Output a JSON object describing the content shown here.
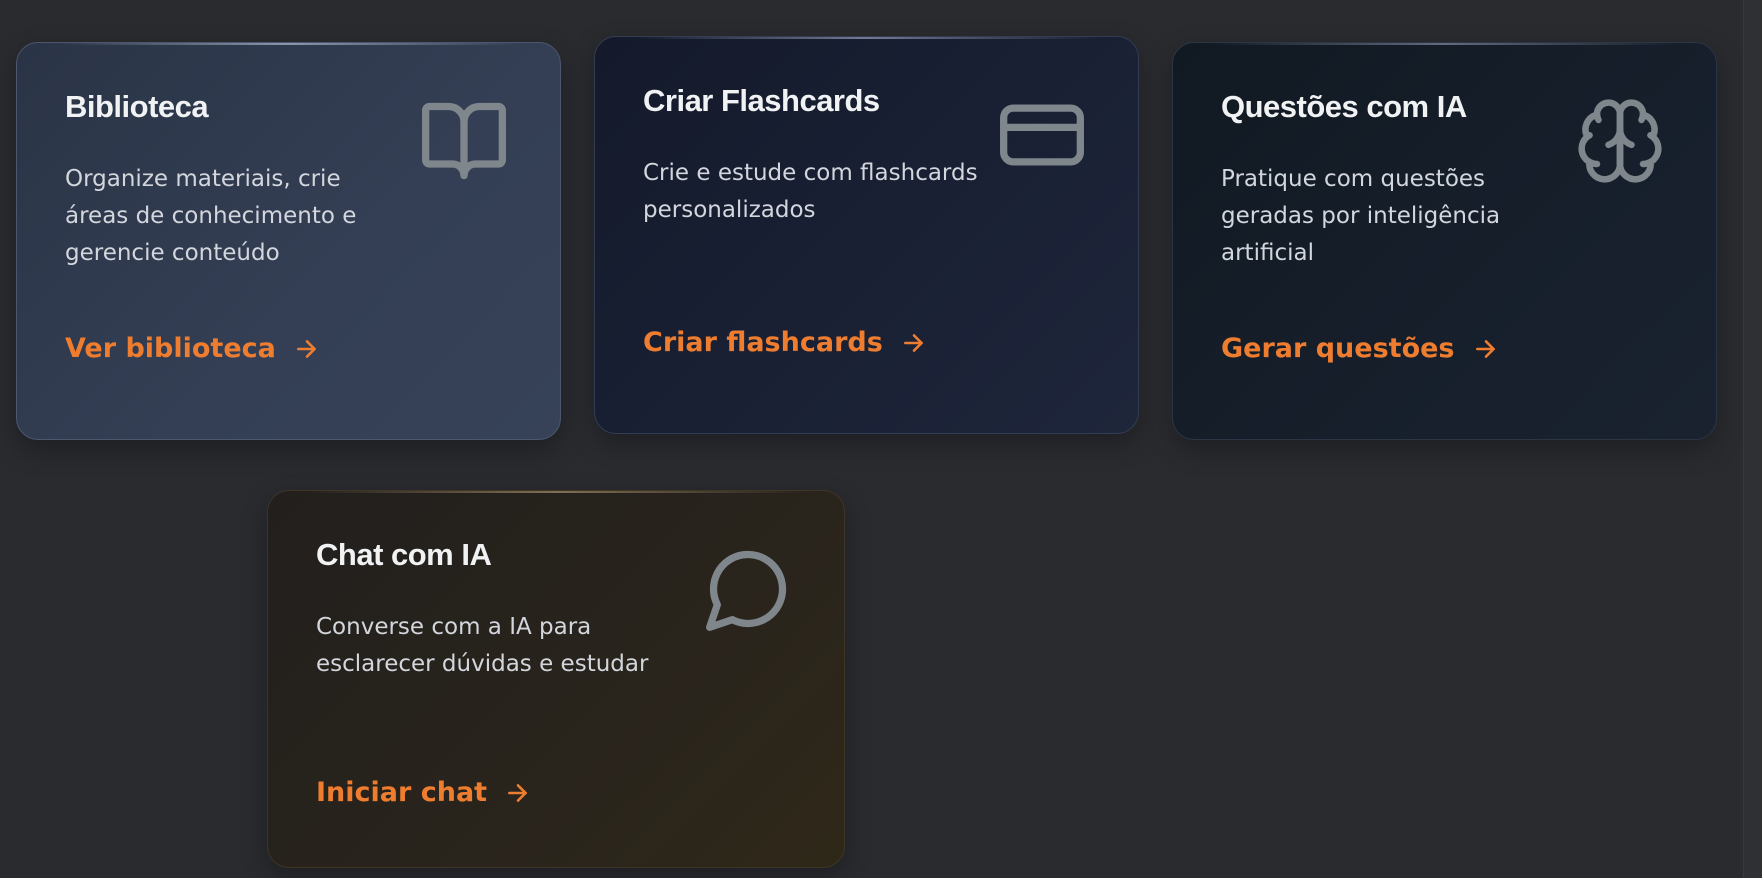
{
  "cards": [
    {
      "title": "Biblioteca",
      "description": "Organize materiais, crie áreas de conhecimento e gerencie conteúdo",
      "action": "Ver biblioteca",
      "icon": "book-open-icon"
    },
    {
      "title": "Criar Flashcards",
      "description": "Crie e estude com flashcards personalizados",
      "action": "Criar flashcards",
      "icon": "credit-card-icon"
    },
    {
      "title": "Questões com IA",
      "description": "Pratique com questões geradas por inteligência artificial",
      "action": "Gerar questões",
      "icon": "brain-icon"
    },
    {
      "title": "Chat com IA",
      "description": "Converse com a IA para esclarecer dúvidas e estudar",
      "action": "Iniciar chat",
      "icon": "message-circle-icon"
    }
  ],
  "colors": {
    "accent": "#ef7d2f",
    "icon": "#7f868c",
    "background": "#2a2b2f"
  }
}
